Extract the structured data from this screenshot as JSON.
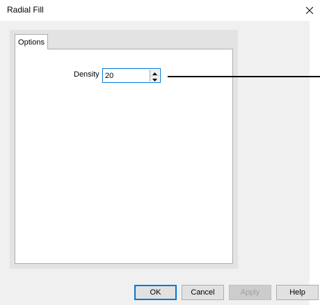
{
  "window": {
    "title": "Radial Fill",
    "close_icon": "close-icon"
  },
  "tabs": [
    {
      "label": "Options",
      "selected": true
    }
  ],
  "options": {
    "density_label": "Density",
    "density_value": "20"
  },
  "buttons": {
    "ok": "OK",
    "cancel": "Cancel",
    "apply": "Apply",
    "help": "Help"
  },
  "colors": {
    "accent": "#0078d7",
    "disabled_text": "#a0a0a0"
  }
}
